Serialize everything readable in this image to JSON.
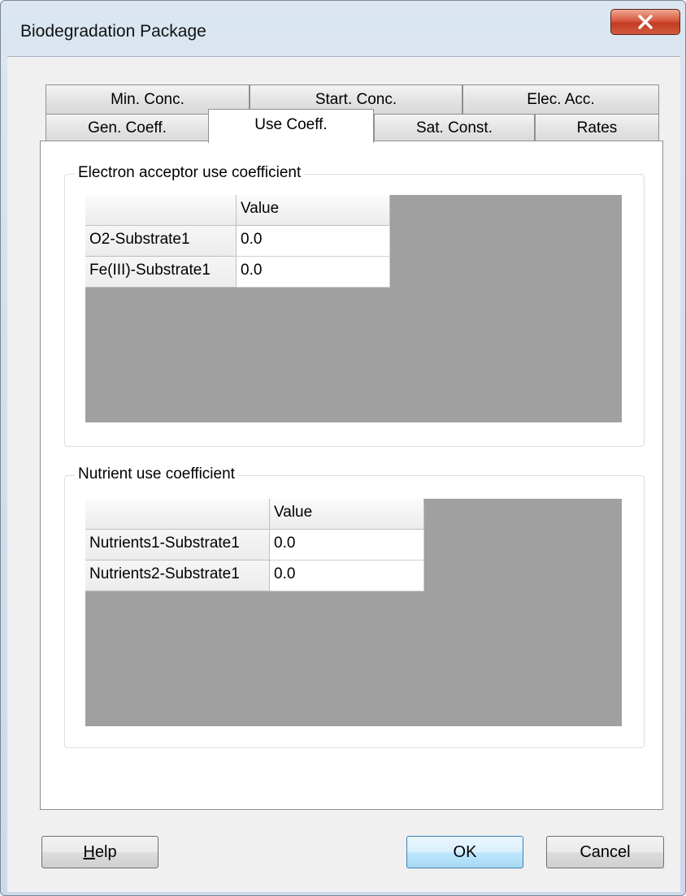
{
  "window": {
    "title": "Biodegradation Package"
  },
  "tabs": {
    "row_back": [
      "Min. Conc.",
      "Start. Conc.",
      "Elec. Acc."
    ],
    "row_front": [
      "Gen. Coeff.",
      "Use Coeff.",
      "Sat. Const.",
      "Rates"
    ],
    "active": "Use Coeff."
  },
  "groups": {
    "electron": {
      "label": "Electron acceptor use coefficient",
      "column_header": "Value",
      "rows": [
        {
          "name": "O2-Substrate1",
          "value": "0.0"
        },
        {
          "name": "Fe(III)-Substrate1",
          "value": "0.0"
        }
      ]
    },
    "nutrient": {
      "label": "Nutrient use coefficient",
      "column_header": "Value",
      "rows": [
        {
          "name": "Nutrients1-Substrate1",
          "value": "0.0"
        },
        {
          "name": "Nutrients2-Substrate1",
          "value": "0.0"
        }
      ]
    }
  },
  "buttons": {
    "help": "Help",
    "ok": "OK",
    "cancel": "Cancel"
  },
  "colors": {
    "grid_background": "#a0a0a0",
    "close_button": "#c94a30",
    "default_button_border": "#3c7fb1"
  },
  "icons": {
    "close": "close-x-icon"
  }
}
